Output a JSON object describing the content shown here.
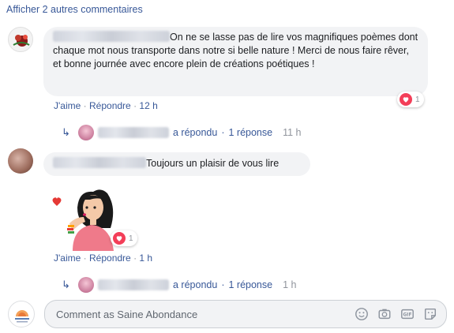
{
  "show_more": "Afficher 2 autres commentaires",
  "comments": [
    {
      "text": "On ne se lasse pas de lire vos magnifiques poèmes dont chaque mot nous transporte dans notre si belle nature ! Merci de nous faire rêver, et bonne journée avec encore plein de créations poétiques !",
      "like": "J'aime",
      "reply": "Répondre",
      "time": "12 h",
      "reaction_count": "1",
      "replies": {
        "verb": "a répondu",
        "count": "1 réponse",
        "time": "11 h"
      }
    },
    {
      "text": "Toujours un plaisir de vous lire",
      "like": "J'aime",
      "reply": "Répondre",
      "time": "1 h",
      "reaction_count": "1",
      "replies": {
        "verb": "a répondu",
        "count": "1 réponse",
        "time": "1 h"
      }
    }
  ],
  "composer": {
    "placeholder": "Comment as Saine Abondance",
    "icons": [
      "emoji-icon",
      "camera-icon",
      "gif-icon",
      "sticker-icon"
    ]
  },
  "colors": {
    "link": "#385898",
    "bubble": "#f2f3f5",
    "heart": "#f33e58",
    "muted": "#90949c"
  }
}
